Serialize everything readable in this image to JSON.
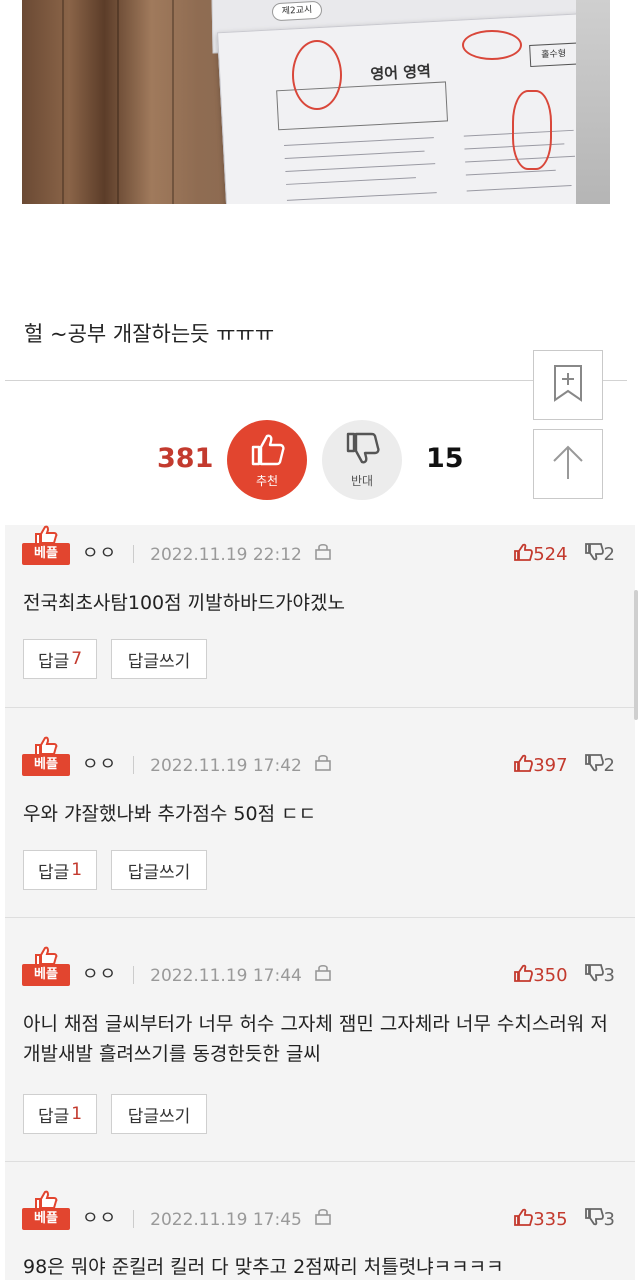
{
  "photo": {
    "tab_label": "제2교시",
    "paper_title": "영어 영역",
    "paper_badge": "홀수형"
  },
  "post": {
    "text": "헐 ~공부 개잘하는듯 ㅠㅠㅠ"
  },
  "side_buttons": {
    "bookmark_icon": "bookmark-plus-icon",
    "top_icon": "arrow-up-icon"
  },
  "votes": {
    "up_count": "381",
    "up_label": "추천",
    "down_count": "15",
    "down_label": "반대"
  },
  "colors": {
    "accent": "#e2452f",
    "accent_text": "#c33a2e"
  },
  "comments": [
    {
      "badge": "베플",
      "author": "ㅇㅇ",
      "date": "2022.11.19 22:12",
      "likes": "524",
      "reports": "2",
      "text": "전국최초사탐100점 끼발하바드가야겠노",
      "reply_label": "답글",
      "reply_count": "7",
      "write_label": "답글쓰기"
    },
    {
      "badge": "베플",
      "author": "ㅇㅇ",
      "date": "2022.11.19 17:42",
      "likes": "397",
      "reports": "2",
      "text": "우와 갸잘했나봐 추가점수 50점 ㄷㄷ",
      "reply_label": "답글",
      "reply_count": "1",
      "write_label": "답글쓰기"
    },
    {
      "badge": "베플",
      "author": "ㅇㅇ",
      "date": "2022.11.19 17:44",
      "likes": "350",
      "reports": "3",
      "text": "아니 채점 글씨부터가 너무 허수 그자체 잼민 그자체라 너무 수치스러워 저 개발새발 흘려쓰기를 동경한듯한 글씨",
      "reply_label": "답글",
      "reply_count": "1",
      "write_label": "답글쓰기"
    },
    {
      "badge": "베플",
      "author": "ㅇㅇ",
      "date": "2022.11.19 17:45",
      "likes": "335",
      "reports": "3",
      "text": "98은 뭐야 준킬러 킬러 다 맞추고 2점짜리 처틀렷냐ㅋㅋㅋㅋ"
    }
  ]
}
